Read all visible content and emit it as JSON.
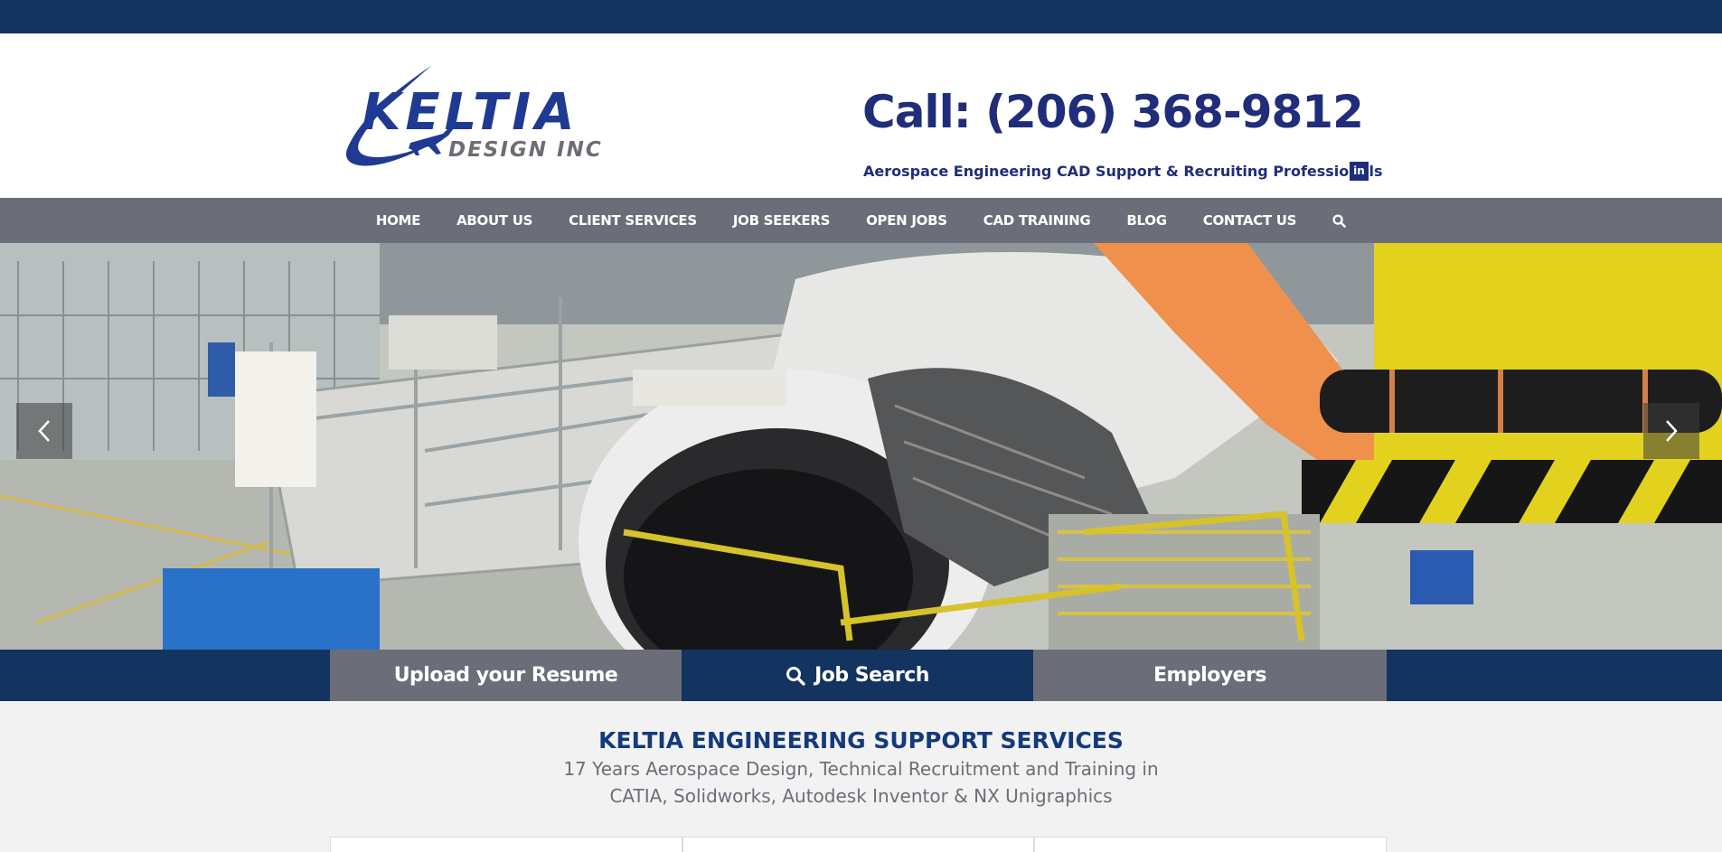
{
  "header": {
    "logo_main": "KELTIA",
    "logo_sub": "DESIGN INC",
    "call": "Call: (206) 368-9812",
    "tagline": "Aerospace Engineering CAD Support & Recruiting Professionals",
    "social": {
      "label": "in",
      "icon": "linkedin-icon"
    }
  },
  "nav": {
    "items": [
      {
        "label": "HOME"
      },
      {
        "label": "ABOUT US"
      },
      {
        "label": "CLIENT SERVICES"
      },
      {
        "label": "JOB SEEKERS"
      },
      {
        "label": "OPEN JOBS"
      },
      {
        "label": "CAD TRAINING"
      },
      {
        "label": "BLOG"
      },
      {
        "label": "CONTACT US"
      }
    ],
    "search_icon": "search-icon"
  },
  "hero": {
    "prev_icon": "chevron-left-icon",
    "next_icon": "chevron-right-icon"
  },
  "cta": {
    "upload": "Upload your Resume",
    "jobs": "Job Search",
    "jobs_icon": "search-icon",
    "employers": "Employers"
  },
  "intro": {
    "title": "KELTIA ENGINEERING SUPPORT SERVICES",
    "line1": "17 Years Aerospace Design, Technical Recruitment and Training in",
    "line2": "CATIA, Solidworks, Autodesk Inventor & NX Unigraphics"
  },
  "colors": {
    "navy": "#133361",
    "gray": "#6b6e78",
    "brand_blue": "#1f2d7a",
    "background": "#f2f2f2"
  }
}
